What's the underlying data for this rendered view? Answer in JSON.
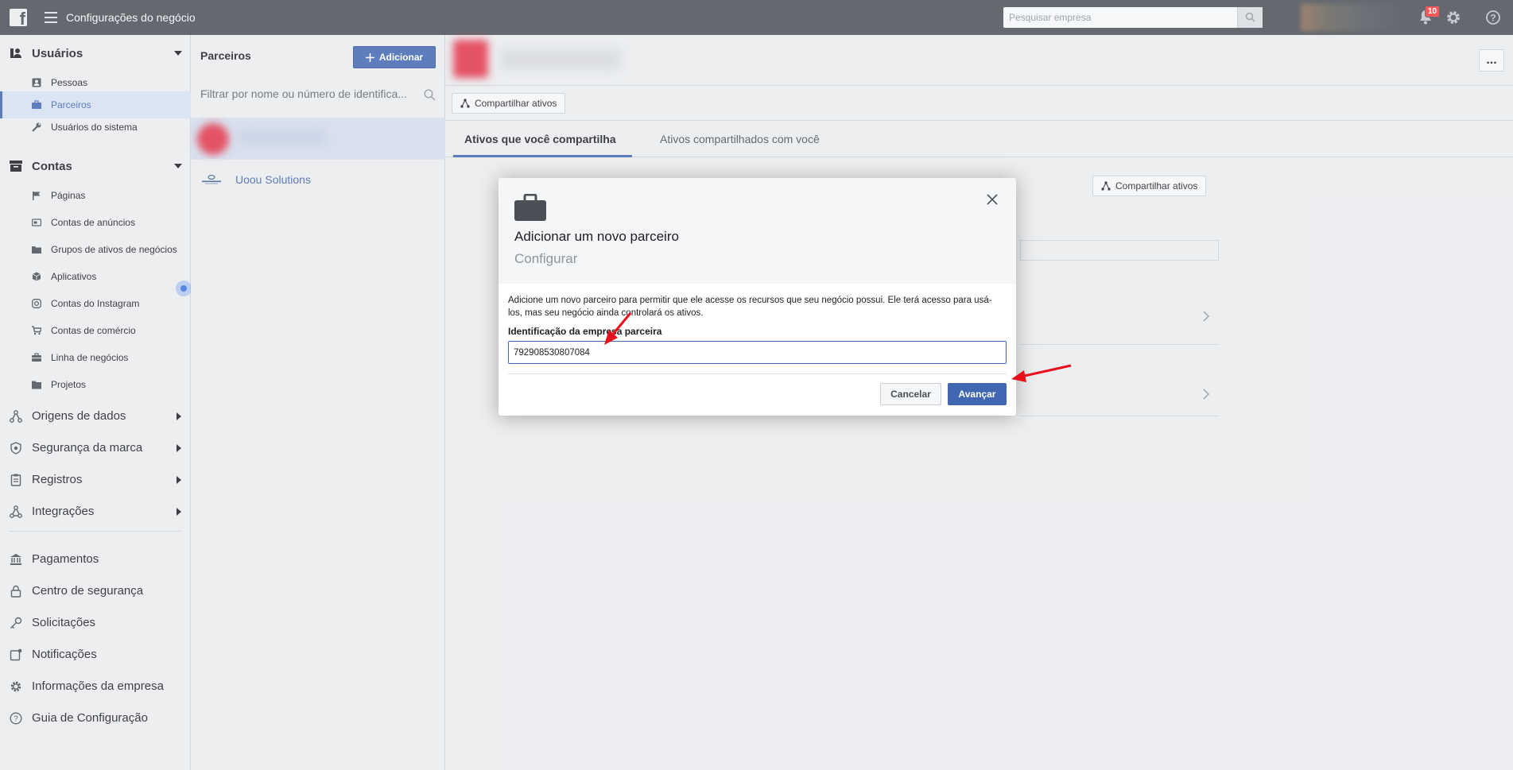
{
  "topbar": {
    "title": "Configurações do negócio",
    "search_placeholder": "Pesquisar empresa",
    "notification_count": "10"
  },
  "sidebar": {
    "users_section": "Usuários",
    "users_items": [
      "Pessoas",
      "Parceiros",
      "Usuários do sistema"
    ],
    "accounts_section": "Contas",
    "accounts_items": [
      "Páginas",
      "Contas de anúncios",
      "Grupos de ativos de negócios",
      "Aplicativos",
      "Contas do Instagram",
      "Contas de comércio",
      "Linha de negócios",
      "Projetos"
    ],
    "expandable": [
      "Origens de dados",
      "Segurança da marca",
      "Registros",
      "Integrações"
    ],
    "bottom": [
      "Pagamentos",
      "Centro de segurança",
      "Solicitações",
      "Notificações",
      "Informações da empresa",
      "Guia de Configuração"
    ]
  },
  "partners": {
    "title": "Parceiros",
    "add_label": "Adicionar",
    "filter_placeholder": "Filtrar por nome ou número de identifica...",
    "items": [
      "Uoou Solutions"
    ]
  },
  "main": {
    "share_assets_label": "Compartilhar ativos",
    "tabs": [
      "Ativos que você compartilha",
      "Ativos compartilhados com você"
    ],
    "more_label": "..."
  },
  "modal": {
    "title": "Adicionar um novo parceiro",
    "step": "Configurar",
    "description": "Adicione um novo parceiro para permitir que ele acesse os recursos que seu negócio possui. Ele terá acesso para usá-los, mas seu negócio ainda controlará os ativos.",
    "field_label": "Identificação da empresa parceira",
    "field_value": "792908530807084",
    "cancel_label": "Cancelar",
    "next_label": "Avançar"
  },
  "colors": {
    "accent": "#4267b2",
    "topbar": "#4b4f56",
    "annotation_arrow": "#e8101a"
  }
}
